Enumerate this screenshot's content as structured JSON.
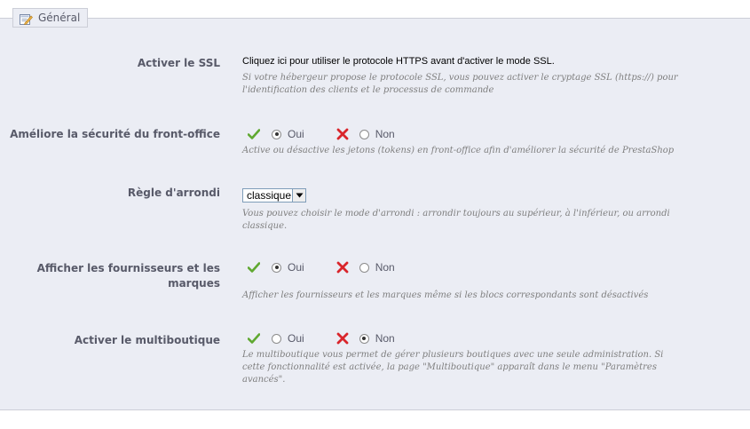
{
  "section": {
    "title": "Général",
    "icon": "form-edit-icon"
  },
  "ssl": {
    "label": "Activer le SSL",
    "link_text": "Cliquez ici pour utiliser le protocole HTTPS avant d'activer le mode SSL.",
    "description": "Si votre hébergeur propose le protocole SSL, vous pouvez activer le cryptage SSL (https://) pour l'identification des clients et le processus de commande"
  },
  "token": {
    "label": "Améliore la sécurité du front-office",
    "yes_label": "Oui",
    "no_label": "Non",
    "selected": "yes",
    "description": "Active ou désactive les jetons (tokens) en front-office afin d'améliorer la sécurité de PrestaShop"
  },
  "rounding": {
    "label": "Règle d'arrondi",
    "selected_value": "classique",
    "description": "Vous pouvez choisir le mode d'arrondi : arrondir toujours au supérieur, à l'inférieur, ou arrondi classique."
  },
  "suppliers": {
    "label": "Afficher les fournisseurs et les marques",
    "yes_label": "Oui",
    "no_label": "Non",
    "selected": "yes",
    "description": "Afficher les fournisseurs et les marques même si les blocs correspondants sont désactivés"
  },
  "multishop": {
    "label": "Activer le multiboutique",
    "yes_label": "Oui",
    "no_label": "Non",
    "selected": "no",
    "description": "Le multiboutique vous permet de gérer plusieurs boutiques avec une seule administration. Si cette fonctionnalité est activée, la page \"Multiboutique\" apparaît dans le menu \"Paramètres avancés\"."
  },
  "colors": {
    "panel_bg": "#ebedf4",
    "label_text": "#585a69",
    "check_green": "#5fa830",
    "cross_red": "#d9252b"
  }
}
